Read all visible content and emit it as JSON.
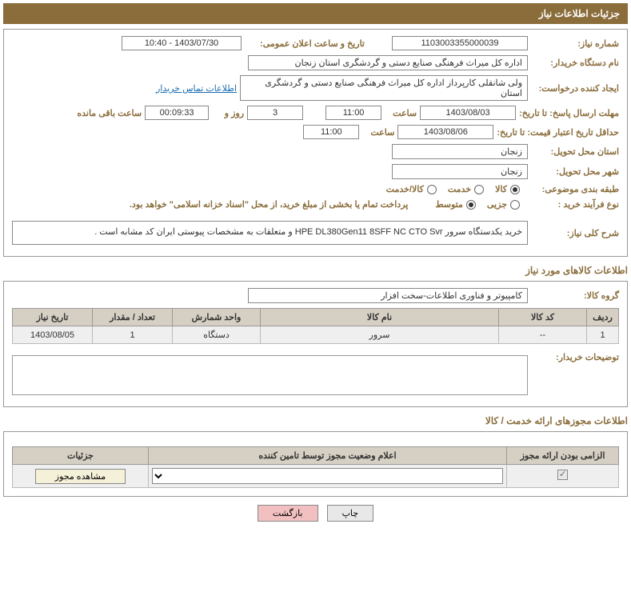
{
  "header": {
    "title": "جزئیات اطلاعات نیاز"
  },
  "need": {
    "number_label": "شماره نیاز:",
    "number": "1103003355000039",
    "announce_label": "تاریخ و ساعت اعلان عمومی:",
    "announce": "1403/07/30 - 10:40",
    "buyer_org_label": "نام دستگاه خریدار:",
    "buyer_org": "اداره کل میراث فرهنگی  صنایع دستی و گردشگری استان زنجان",
    "requester_label": "ایجاد کننده درخواست:",
    "requester": "ولی شانقلی کارپرداز اداره کل میراث فرهنگی  صنایع دستی و گردشگری استان",
    "contact_link": "اطلاعات تماس خریدار",
    "resp_deadline_label": "مهلت ارسال پاسخ: تا تاریخ:",
    "resp_date": "1403/08/03",
    "time_label": "ساعت",
    "resp_time": "11:00",
    "days": "3",
    "days_label": "روز و",
    "remain": "00:09:33",
    "remain_label": "ساعت باقی مانده",
    "valid_deadline_label": "حداقل تاریخ اعتبار قیمت: تا تاریخ:",
    "valid_date": "1403/08/06",
    "valid_time": "11:00",
    "province_label": "استان محل تحویل:",
    "province": "زنجان",
    "city_label": "شهر محل تحویل:",
    "city": "زنجان",
    "category_label": "طبقه بندی موضوعی:",
    "cat_goods": "کالا",
    "cat_service": "خدمت",
    "cat_both": "کالا/خدمت",
    "process_label": "نوع فرآیند خرید :",
    "proc_small": "جزیی",
    "proc_medium": "متوسط",
    "payment_note": "پرداخت تمام یا بخشی از مبلغ خرید، از محل \"اسناد خزانه اسلامی\" خواهد بود.",
    "summary_label": "شرح کلی نیاز:",
    "summary": "خرید یکدستگاه سرور HPE DL380Gen11 8SFF NC CTO Svr و متعلقات به مشخصات پیوستی ایران کد مشابه است ."
  },
  "goods": {
    "section_title": "اطلاعات کالاهای مورد نیاز",
    "group_label": "گروه کالا:",
    "group": "کامپیوتر و فناوری اطلاعات-سخت افزار",
    "headers": {
      "row": "ردیف",
      "code": "کد کالا",
      "name": "نام کالا",
      "unit": "واحد شمارش",
      "qty": "تعداد / مقدار",
      "date": "تاریخ نیاز"
    },
    "items": [
      {
        "row": "1",
        "code": "--",
        "name": "سرور",
        "unit": "دستگاه",
        "qty": "1",
        "date": "1403/08/05"
      }
    ],
    "buyer_notes_label": "توضیحات خریدار:"
  },
  "licenses": {
    "section_title": "اطلاعات مجوزهای ارائه خدمت / کالا",
    "headers": {
      "mandatory": "الزامی بودن ارائه مجوز",
      "status": "اعلام وضعیت مجوز توسط تامین کننده",
      "details": "جزئیات"
    },
    "view_btn": "مشاهده مجوز"
  },
  "buttons": {
    "print": "چاپ",
    "back": "بازگشت"
  }
}
